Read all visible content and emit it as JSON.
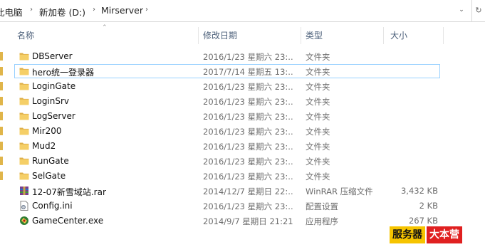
{
  "breadcrumb": {
    "items": [
      "此电脑",
      "新加卷 (D:)",
      "Mirserver"
    ]
  },
  "columns": {
    "name": "名称",
    "modified": "修改日期",
    "type": "类型",
    "size": "大小"
  },
  "files": [
    {
      "name": "DBServer",
      "modified": "2016/1/23 星期六 23:..",
      "type": "文件夹",
      "size": "",
      "icon": "folder-icon"
    },
    {
      "name": "hero统一登录器",
      "modified": "2017/7/14 星期五 13:..",
      "type": "文件夹",
      "size": "",
      "icon": "folder-icon",
      "selected": true
    },
    {
      "name": "LoginGate",
      "modified": "2016/1/23 星期六 23:..",
      "type": "文件夹",
      "size": "",
      "icon": "folder-icon"
    },
    {
      "name": "LoginSrv",
      "modified": "2016/1/23 星期六 23:..",
      "type": "文件夹",
      "size": "",
      "icon": "folder-icon"
    },
    {
      "name": "LogServer",
      "modified": "2016/1/23 星期六 23:..",
      "type": "文件夹",
      "size": "",
      "icon": "folder-icon"
    },
    {
      "name": "Mir200",
      "modified": "2016/1/23 星期六 23:..",
      "type": "文件夹",
      "size": "",
      "icon": "folder-icon"
    },
    {
      "name": "Mud2",
      "modified": "2016/1/23 星期六 23:..",
      "type": "文件夹",
      "size": "",
      "icon": "folder-icon"
    },
    {
      "name": "RunGate",
      "modified": "2016/1/23 星期六 23:..",
      "type": "文件夹",
      "size": "",
      "icon": "folder-icon"
    },
    {
      "name": "SelGate",
      "modified": "2016/1/23 星期六 23:..",
      "type": "文件夹",
      "size": "",
      "icon": "folder-icon"
    },
    {
      "name": "12-07新雪域站.rar",
      "modified": "2014/12/7 星期日 22:..",
      "type": "WinRAR 压缩文件",
      "size": "3,432 KB",
      "icon": "rar-archive-icon"
    },
    {
      "name": "Config.ini",
      "modified": "2016/1/23 星期六 23:..",
      "type": "配置设置",
      "size": "2 KB",
      "icon": "config-file-icon"
    },
    {
      "name": "GameCenter.exe",
      "modified": "2014/9/7 星期日 21:21",
      "type": "应用程序",
      "size": "267 KB",
      "icon": "app-exe-icon"
    }
  ],
  "watermark": {
    "part1": "服务器",
    "part2": "大本营"
  },
  "colors": {
    "folder": "#e8b84a",
    "selection_border": "#99d1ff",
    "header_text": "#4c607a"
  }
}
